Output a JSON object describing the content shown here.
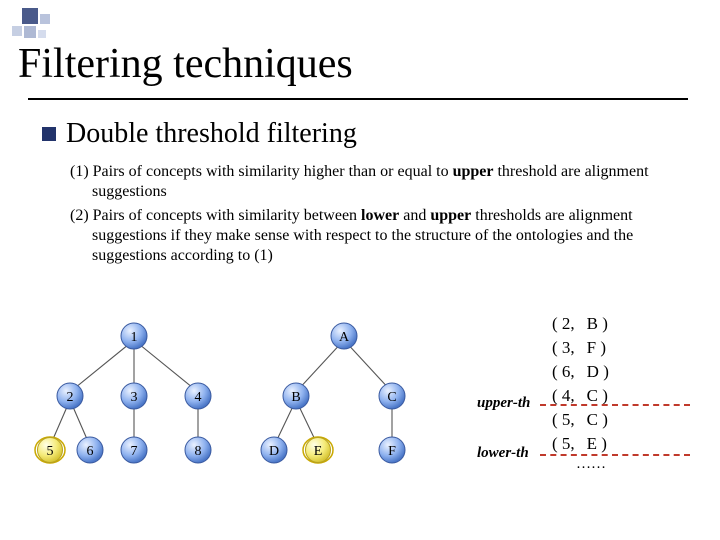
{
  "title": "Filtering techniques",
  "heading": "Double threshold filtering",
  "rule1": "(1) Pairs of concepts with similarity higher than or equal to upper threshold are alignment suggestions",
  "rule2": "(2) Pairs of concepts with similarity between lower and upper thresholds are alignment suggestions if they make sense with respect to the structure of the ontologies and the suggestions according to (1)",
  "upper_label": "upper-th",
  "lower_label": "lower-th",
  "pairs": {
    "r0a": "( 2,",
    "r0b": "B )",
    "r1a": "( 3,",
    "r1b": "F )",
    "r2a": "( 6,",
    "r2b": "D )",
    "r3a": "( 4,",
    "r3b": "C )",
    "r4a": "( 5,",
    "r4b": "C )",
    "r5a": "( 5,",
    "r5b": "E )",
    "ell": "……"
  },
  "tree1": {
    "n1": "1",
    "n2": "2",
    "n3": "3",
    "n4": "4",
    "n5": "5",
    "n6": "6",
    "n7": "7",
    "n8": "8"
  },
  "tree2": {
    "na": "A",
    "nb": "B",
    "nc": "C",
    "nd": "D",
    "ne": "E",
    "nf": "F"
  }
}
